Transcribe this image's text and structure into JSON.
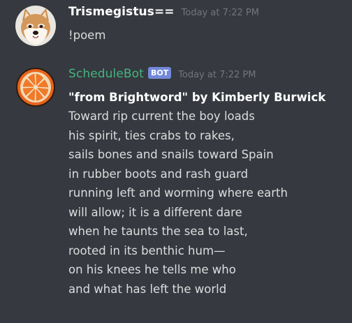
{
  "messages": [
    {
      "author": "Trismegistus==",
      "timestamp": "Today at 7:22 PM",
      "avatar_icon": "shiba-dog-avatar",
      "text": "!poem"
    },
    {
      "author": "ScheduleBot",
      "bot_tag": "BOT",
      "timestamp": "Today at 7:22 PM",
      "avatar_icon": "orange-slice-avatar",
      "title": "\"from Brightword\" by Kimberly  Burwick",
      "lines": [
        "Toward rip current the boy loads",
        "his spirit, ties crabs to rakes,",
        "sails bones and snails toward Spain",
        "in rubber boots and rash guard",
        "running left and worming where earth",
        "will allow; it is a different dare",
        "when he taunts the sea to last,",
        "rooted in its benthic hum—",
        "on his knees he tells me who",
        "and what has left the world"
      ]
    }
  ],
  "colors": {
    "background": "#36393f",
    "bot_name": "#43b581",
    "bot_tag": "#7289da",
    "timestamp": "#72767d",
    "text": "#dcddde"
  }
}
